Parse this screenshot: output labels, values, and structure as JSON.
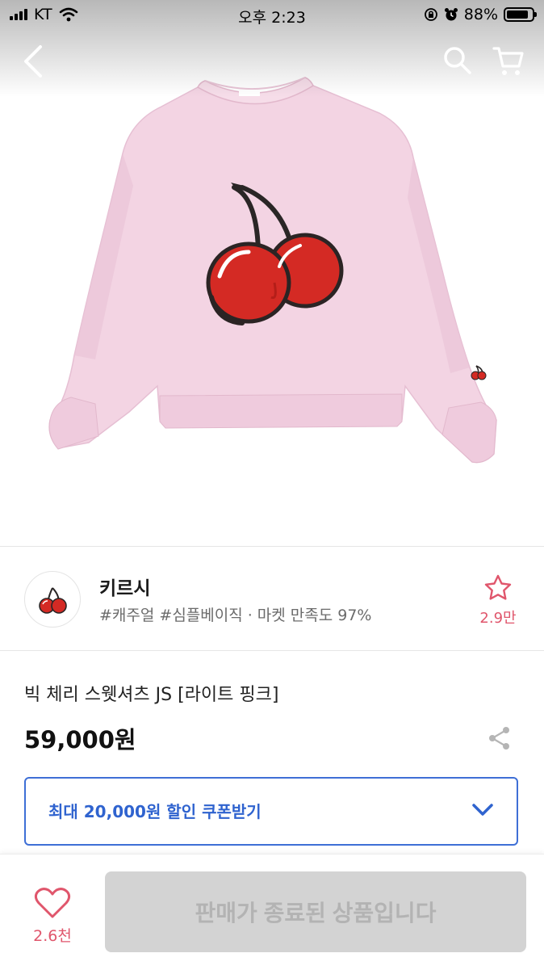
{
  "status_bar": {
    "carrier": "KT",
    "time": "오후 2:23",
    "battery_percent": "88%",
    "battery_level": 0.88
  },
  "shop": {
    "name": "키르시",
    "tags": "#캐주얼 #심플베이직",
    "separator": "·",
    "satisfaction": "마켓 만족도 97%",
    "favorite_count": "2.9만"
  },
  "product": {
    "name": "빅 체리 스웻셔츠 JS [라이트 핑크]",
    "price": "59,000원",
    "hero_icon": "pink-cherry-sweatshirt-image"
  },
  "coupon": {
    "label": "최대 20,000원 할인 쿠폰받기"
  },
  "bottom_bar": {
    "like_count": "2.6천",
    "sold_out_label": "판매가 종료된 상품입니다"
  },
  "colors": {
    "accent_blue": "#3e6fd6",
    "accent_pink": "#e0566c",
    "sweatshirt": "#f3d4e3",
    "cherry_red": "#d42a24",
    "disabled_bg": "#d3d3d3"
  }
}
